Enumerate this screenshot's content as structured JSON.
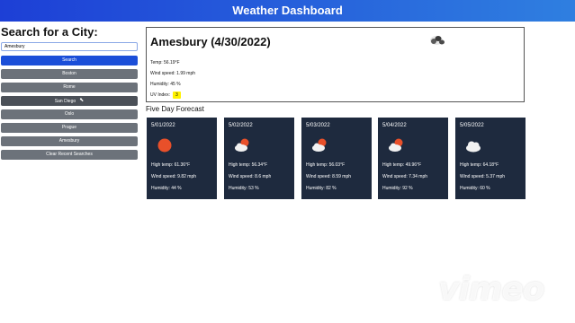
{
  "header": {
    "title": "Weather Dashboard"
  },
  "sidebar": {
    "heading": "Search for a City:",
    "search_value": "Amesbury",
    "search_button": "Search",
    "history": [
      "Boston",
      "Rome",
      "San Diego",
      "Oslo",
      "Prague",
      "Amesbury"
    ],
    "clear_button": "Clear Recent Searches"
  },
  "current": {
    "title": "Amesbury (4/30/2022)",
    "temp": "Temp: 56.19°F",
    "wind": "Wind speed: 1.99 mph",
    "humidity": "Humidity: 45 %",
    "uv_label": "UV Index:",
    "uv_value": "3",
    "icon": "broken-clouds-icon"
  },
  "forecast": {
    "title": "Five Day Forecast",
    "days": [
      {
        "date": "5/01/2022",
        "icon": "sun-icon",
        "high": "High temp: 61.36°F",
        "wind": "Wind speed: 9.82 mph",
        "humidity": "Humidity: 44 %"
      },
      {
        "date": "5/02/2022",
        "icon": "partly-cloudy-icon",
        "high": "High temp: 56.34°F",
        "wind": "Wind speed: 8.6 mph",
        "humidity": "Humidity: 53 %"
      },
      {
        "date": "5/03/2022",
        "icon": "partly-cloudy-icon",
        "high": "High temp: 56.03°F",
        "wind": "Wind speed: 8.59 mph",
        "humidity": "Humidity: 82 %"
      },
      {
        "date": "5/04/2022",
        "icon": "partly-cloudy-icon",
        "high": "High temp: 49.96°F",
        "wind": "Wind speed: 7.34 mph",
        "humidity": "Humidity: 92 %"
      },
      {
        "date": "5/05/2022",
        "icon": "cloud-icon",
        "high": "High temp: 64.18°F",
        "wind": "Wind speed: 5.37 mph",
        "humidity": "Humidity: 60 %"
      }
    ]
  },
  "colors": {
    "header": "#1d3fd6",
    "primary_button": "#1b4ed8",
    "card_bg": "#1e2a3e",
    "uv_badge": "#fff200",
    "sun": "#e8502a"
  },
  "watermark": "vimeo"
}
